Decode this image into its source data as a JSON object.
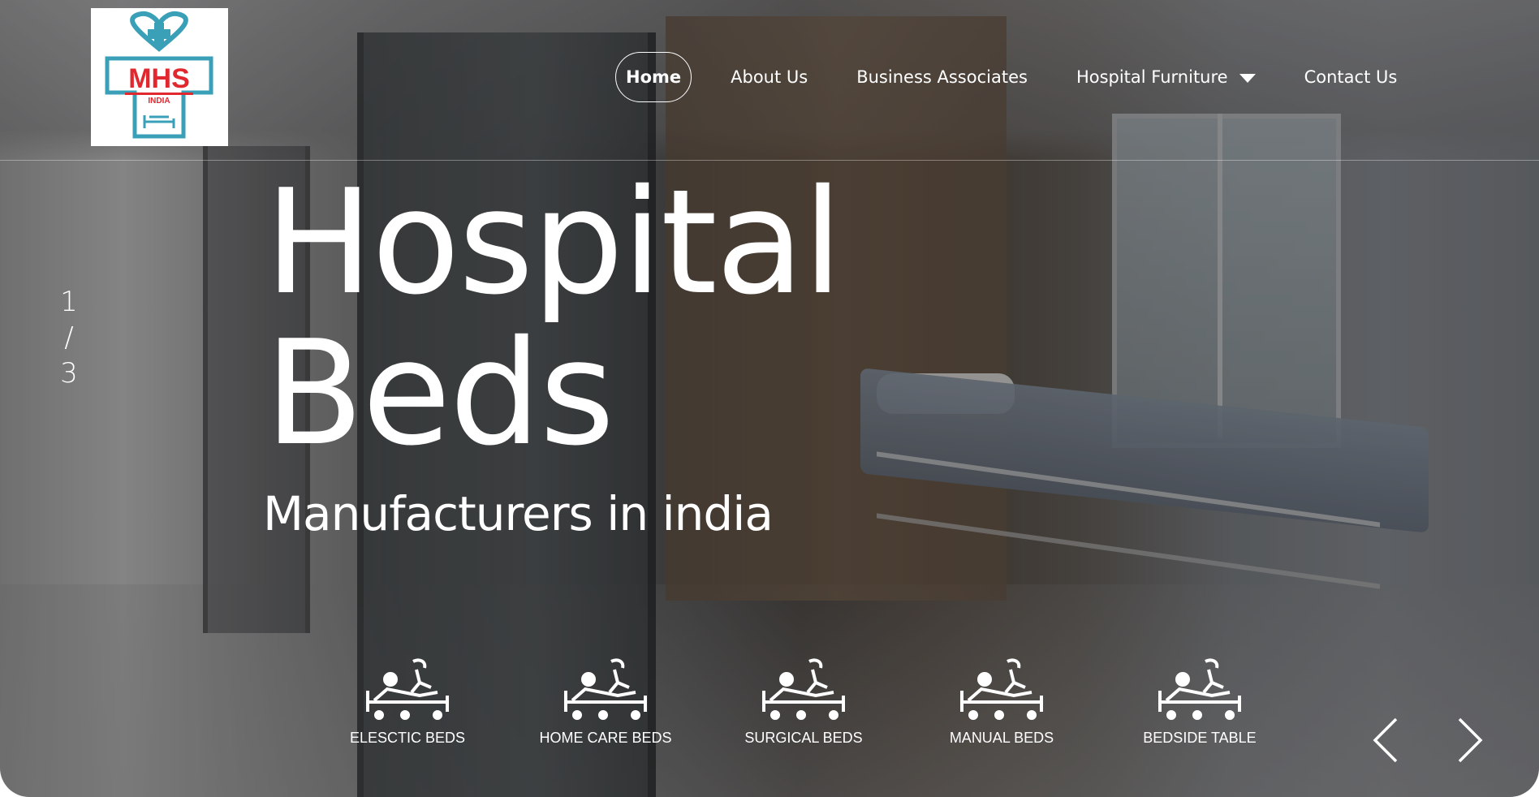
{
  "nav": {
    "items": [
      {
        "label": "Home",
        "active": true
      },
      {
        "label": "About Us"
      },
      {
        "label": "Business Associates"
      },
      {
        "label": "Hospital Furniture",
        "has_dropdown": true
      },
      {
        "label": "Contact Us"
      }
    ]
  },
  "logo": {
    "brand": "MHS",
    "country": "INDIA"
  },
  "slider": {
    "current": "1",
    "separator": "/",
    "total": "3"
  },
  "hero": {
    "line1": "Hospital",
    "line2": "Beds",
    "subtitle": "Manufacturers in india"
  },
  "categories": [
    {
      "label": "ELESCTIC BEDS",
      "icon": "hospital-bed-icon"
    },
    {
      "label": "HOME CARE BEDS",
      "icon": "hospital-bed-icon"
    },
    {
      "label": "SURGICAL BEDS",
      "icon": "hospital-bed-icon"
    },
    {
      "label": "MANUAL BEDS",
      "icon": "hospital-bed-icon"
    },
    {
      "label": "BEDSIDE TABLE",
      "icon": "hospital-bed-icon"
    }
  ],
  "colors": {
    "logo_red": "#e0282e",
    "logo_teal": "#3aa0b8",
    "text": "#ffffff"
  }
}
